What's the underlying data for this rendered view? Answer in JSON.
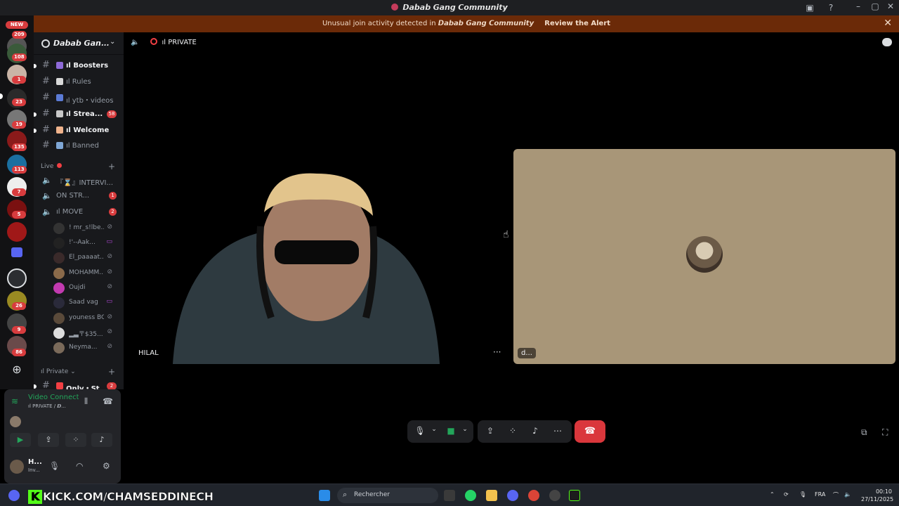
{
  "window": {
    "title": "𝘿𝙖𝙗𝙖𝙗 𝙂𝙖𝙣𝙜 𝘾𝙤𝙢𝙢𝙪𝙣𝙞𝙩𝙮"
  },
  "alert": {
    "message": "Unusual join activity detected in",
    "server": "𝘿𝙖𝙗𝙖𝙗 𝙂𝙖𝙣𝙜 𝘾𝙤𝙢𝙢𝙪𝙣𝙞𝙩𝙮",
    "action": "Review the Alert"
  },
  "guilds": {
    "new_label": "NEW",
    "badges": [
      "209",
      "108",
      "1",
      "23",
      "19",
      "135",
      "113",
      "7",
      "5",
      "26",
      "9",
      "86"
    ]
  },
  "server": {
    "name": "𝘿𝙖𝙗𝙖𝙗 𝙂𝙖𝙣..."
  },
  "channels": [
    {
      "label": "ıl Boosters",
      "unread": true,
      "count": ""
    },
    {
      "label": "ıl Rules",
      "unread": false,
      "count": ""
    },
    {
      "label": "ıl ytb・videos",
      "unread": false,
      "count": ""
    },
    {
      "label": "ıl Strea...",
      "unread": true,
      "count": "58"
    },
    {
      "label": "ıl Welcome",
      "unread": true,
      "count": ""
    },
    {
      "label": "ıl Banned",
      "unread": false,
      "count": ""
    }
  ],
  "categories": {
    "live": "Live",
    "private": "ıl Private"
  },
  "voice_channels": [
    {
      "label": "『⌛』INTERVI...",
      "count": ""
    },
    {
      "label": "ON STR...",
      "count": "1"
    },
    {
      "label": "ıl MOVE",
      "count": "2"
    }
  ],
  "voice_users": [
    "! mr_s!lbe...",
    "!'--Aak...",
    "El_paaaat...",
    "MOHAMM...",
    "Oujdi",
    "Saad vag",
    "youness BG",
    "▂▃〒$35...",
    "Neyma..."
  ],
  "private_channel": {
    "label": "Only・St...",
    "count": "2"
  },
  "panel": {
    "status": "Video Connected",
    "sub": "ıl PRIVATE / 𝘿...",
    "user_name": "H...",
    "user_status": "Inv..."
  },
  "call": {
    "channel": "ıl PRIVATE",
    "left_tile_name": "HILAL",
    "right_tile_name": "d...",
    "more": "···"
  },
  "taskbar": {
    "overlay_text": "KICK.COM/CHAMSEDDINECH",
    "search_placeholder": "Rechercher",
    "lang": "FRA",
    "time": "00:10",
    "date": "27/11/2025"
  },
  "colors": {
    "alert_bg": "#6b2a08",
    "hangup": "#da373c",
    "connected": "#23a55a",
    "right_tile_bg": "#a89678"
  }
}
